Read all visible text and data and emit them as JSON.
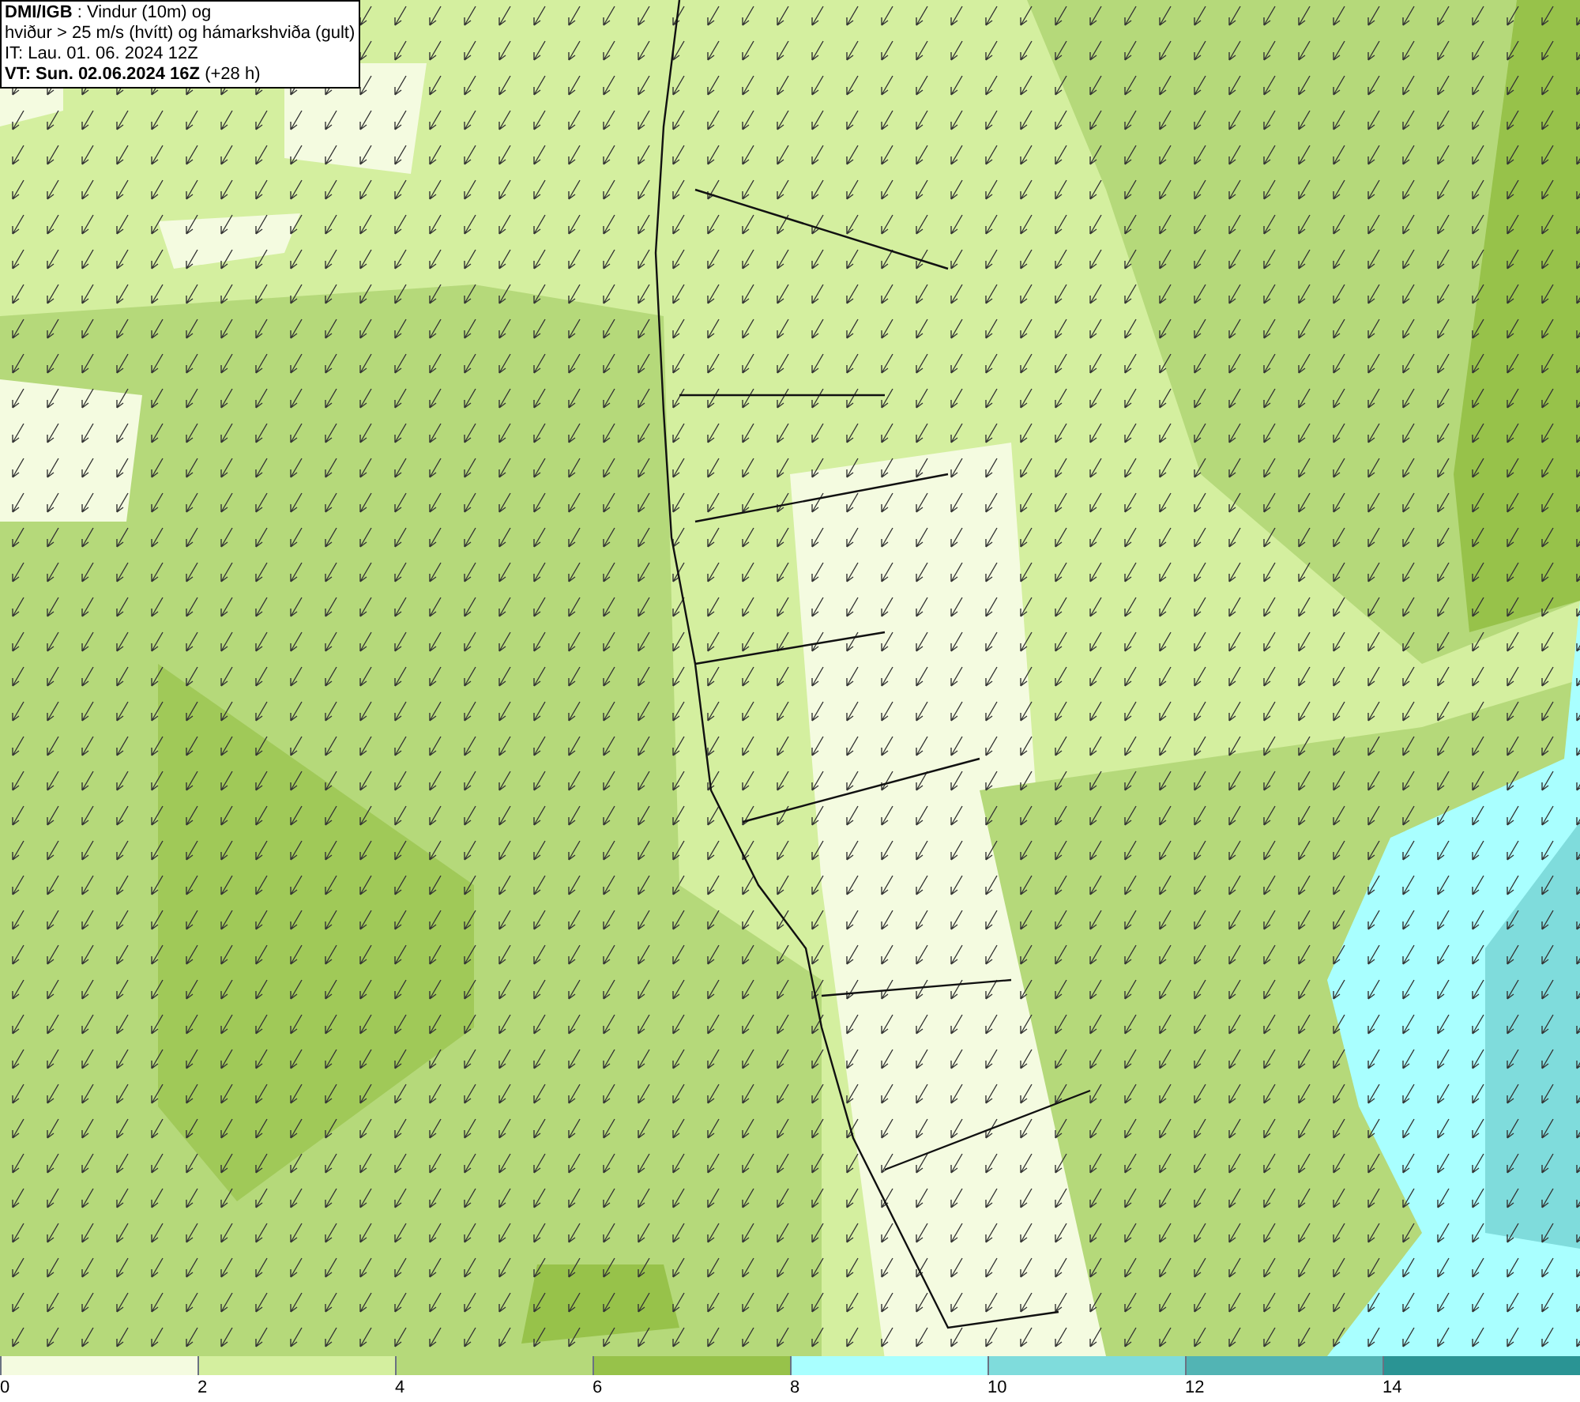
{
  "header": {
    "lines": [
      "**DMI/IGB** : Vindur (10m) og",
      "hviður > 25 m/s (hvítt) og hámarkshviða (gult)",
      "IT: Lau. 01. 06. 2024 12Z",
      "**VT: Sun. 02.06.2024 16Z** (+28 h)"
    ]
  },
  "legend": {
    "items": [
      {
        "label": "0",
        "color": "#f4fbe0"
      },
      {
        "label": "2",
        "color": "#d4ef9f"
      },
      {
        "label": "4",
        "color": "#b5d97a"
      },
      {
        "label": "6",
        "color": "#97c24a"
      },
      {
        "label": "8",
        "color": "#a9ffff"
      },
      {
        "label": "10",
        "color": "#7fdcdc"
      },
      {
        "label": "12",
        "color": "#52b4b4"
      },
      {
        "label": "14",
        "color": "#2a9494"
      }
    ]
  }
}
